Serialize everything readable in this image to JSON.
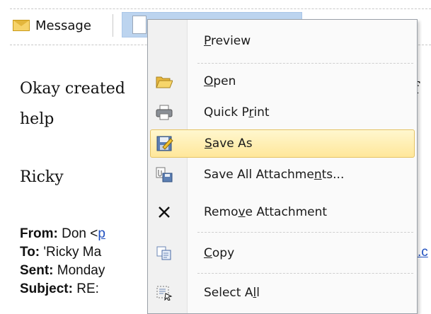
{
  "attachments_bar": {
    "message_tab_label": "Message",
    "attachment_tab_label": ""
  },
  "email": {
    "line1": "Okay created",
    "line1_trailing": "f",
    "line2": "help",
    "signature": "Ricky",
    "from_label": "From:",
    "from_value": "Don <",
    "from_link": "p",
    "to_label": "To:",
    "to_value": "'Ricky Ma",
    "to_trailing_link": ".c",
    "sent_label": "Sent:",
    "sent_value": "Monday",
    "subject_label": "Subject:",
    "subject_value": "RE:"
  },
  "context_menu": {
    "items": [
      {
        "label": "Preview",
        "icon": "preview-icon"
      },
      {
        "label": "Open",
        "icon": "folder-open-icon"
      },
      {
        "label": "Quick Print",
        "icon": "printer-icon"
      },
      {
        "label": "Save As",
        "icon": "save-as-icon",
        "selected": true
      },
      {
        "label": "Save All Attachments...",
        "icon": "save-all-icon"
      },
      {
        "label": "Remove Attachment",
        "icon": "remove-x-icon"
      },
      {
        "label": "Copy",
        "icon": "copy-icon"
      },
      {
        "label": "Select All",
        "icon": "select-all-icon"
      }
    ],
    "highlight_color": "#ffe79a"
  }
}
